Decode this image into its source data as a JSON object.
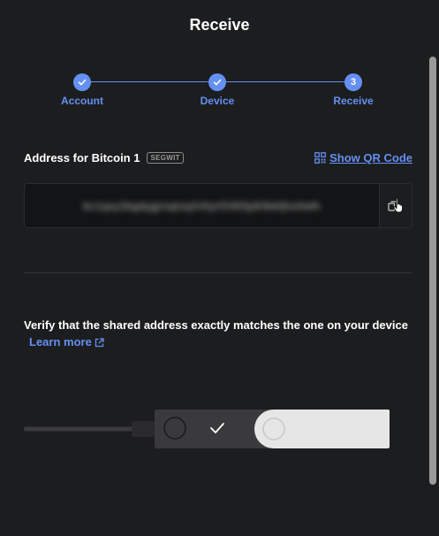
{
  "header": {
    "title": "Receive"
  },
  "stepper": {
    "steps": [
      {
        "label": "Account",
        "state": "done"
      },
      {
        "label": "Device",
        "state": "done"
      },
      {
        "label": "Receive",
        "state": "current",
        "number": "3"
      }
    ]
  },
  "address": {
    "label": "Address for Bitcoin 1",
    "badge": "SEGWIT",
    "show_qr_label": "Show QR Code",
    "value": "bc1qxy2kgdygjrsqtzq2n0yrf2493p83kkfjhx0wlh"
  },
  "verify": {
    "text": "Verify that the shared address exactly matches the one on your device",
    "learn_more": "Learn more"
  },
  "colors": {
    "accent": "#6490f1",
    "background": "#1c1d1f",
    "device_body": "#3a3a3c",
    "device_swivel": "#e6e6e6"
  },
  "icons": {
    "step_done": "check-icon",
    "qr": "qr-code-icon",
    "copy": "copy-icon",
    "external": "external-link-icon",
    "cursor": "mouse-cursor-icon"
  }
}
